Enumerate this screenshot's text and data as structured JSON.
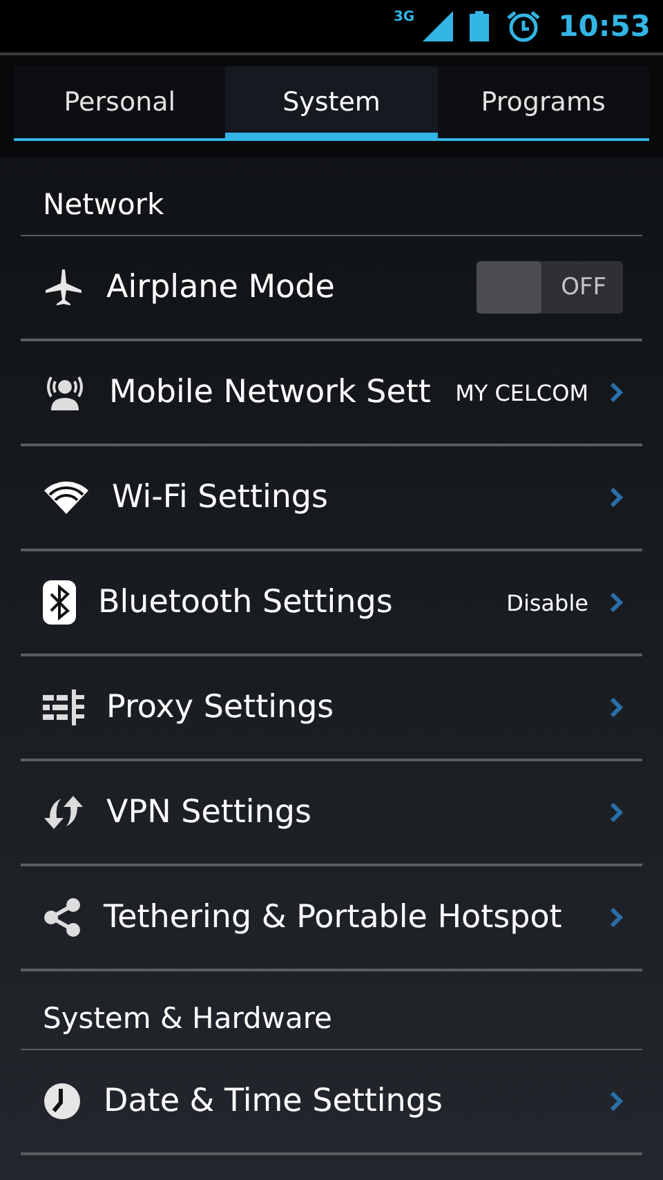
{
  "status_bar": {
    "network": "3G",
    "time": "10:53"
  },
  "tabs": [
    {
      "label": "Personal",
      "selected": false
    },
    {
      "label": "System",
      "selected": true
    },
    {
      "label": "Programs",
      "selected": false
    }
  ],
  "sections": [
    {
      "title": "Network",
      "items": [
        {
          "kind": "toggle",
          "label": "Airplane Mode",
          "on": false,
          "state_text": "OFF"
        },
        {
          "kind": "link",
          "label": "Mobile Network Sett",
          "value": "MY CELCOM"
        },
        {
          "kind": "link",
          "label": "Wi-Fi Settings"
        },
        {
          "kind": "link",
          "label": "Bluetooth Settings",
          "value": "Disable"
        },
        {
          "kind": "link",
          "label": "Proxy Settings"
        },
        {
          "kind": "link",
          "label": "VPN Settings"
        },
        {
          "kind": "link",
          "label": "Tethering & Portable Hotspot"
        }
      ]
    },
    {
      "title": "System & Hardware",
      "items": [
        {
          "kind": "link",
          "label": "Date & Time Settings"
        }
      ]
    }
  ]
}
